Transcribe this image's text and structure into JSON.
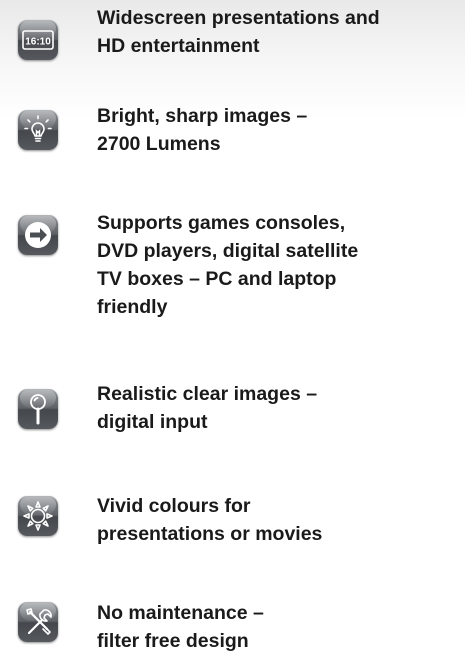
{
  "features": [
    {
      "icon": "widescreen-16-10-icon",
      "icon_text": "16:10",
      "text": "Widescreen presentations and\nHD entertainment"
    },
    {
      "icon": "lightbulb-icon",
      "text": "Bright, sharp images –\n2700 Lumens"
    },
    {
      "icon": "arrow-right-circle-icon",
      "text": "Supports games consoles,\nDVD players, digital satellite\nTV boxes – PC and laptop\nfriendly"
    },
    {
      "icon": "magnifier-icon",
      "text": "Realistic clear images  –\ndigital input"
    },
    {
      "icon": "sun-icon",
      "text": "Vivid colours for\npresentations or movies"
    },
    {
      "icon": "tools-icon",
      "text": "No maintenance –\nfilter free design"
    }
  ]
}
